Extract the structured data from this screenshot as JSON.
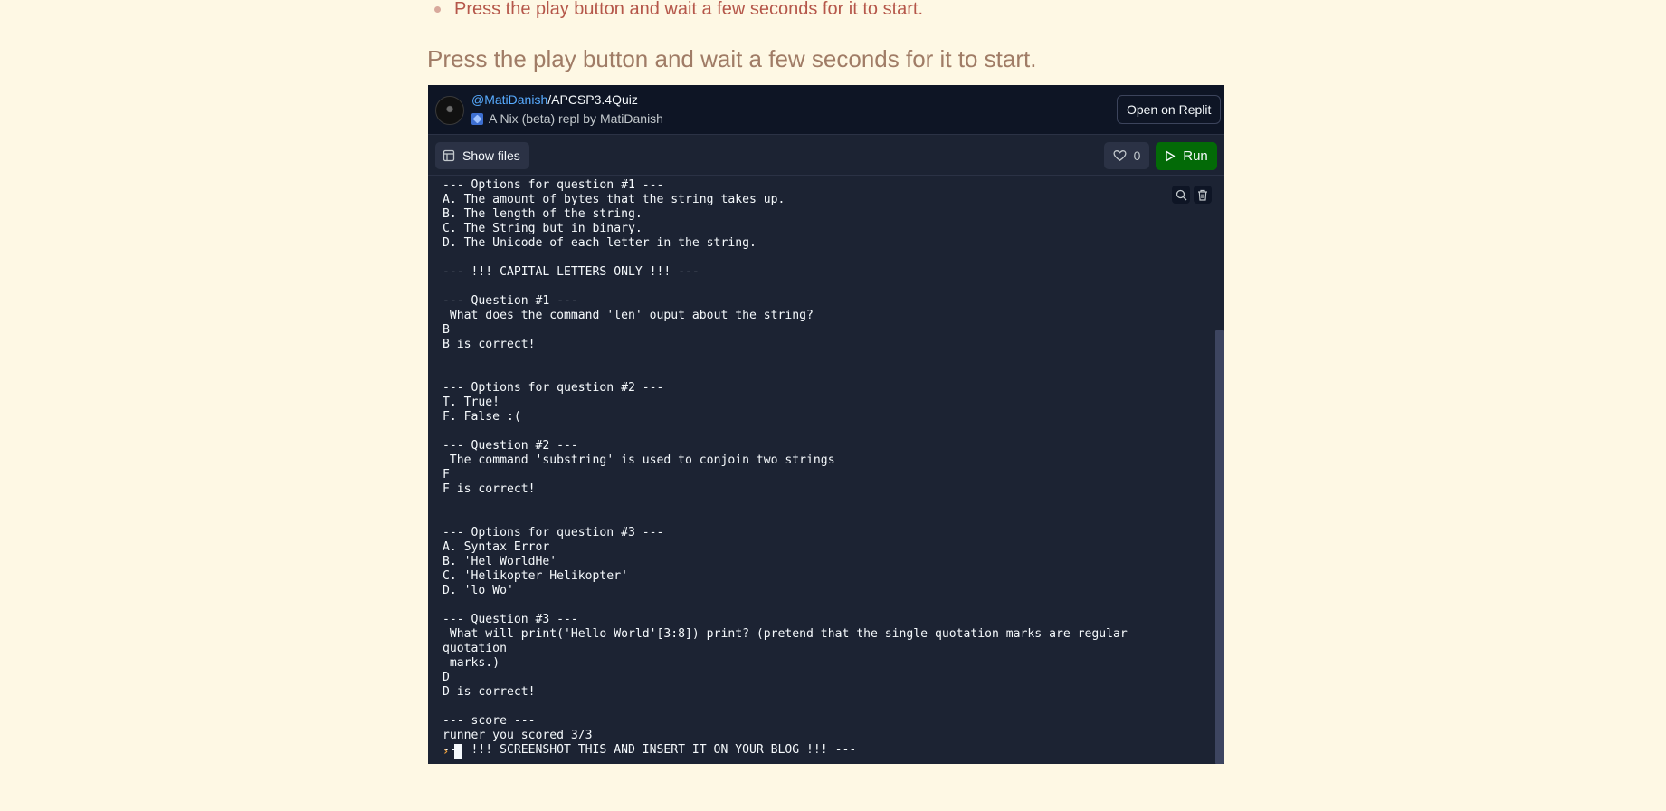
{
  "page": {
    "bullet_text": "Press the play button and wait a few seconds for it to start.",
    "heading": "Press the play button and wait a few seconds for it to start."
  },
  "embed": {
    "owner": "@MatiDanish",
    "separator": "/",
    "repl_name": "APCSP3.4Quiz",
    "subtitle": "A Nix (beta) repl by MatiDanish",
    "open_button": "Open on Replit",
    "show_files_button": "Show files",
    "like_count": "0",
    "run_button": "Run"
  },
  "console": {
    "lines": [
      "--- Options for question #1 ---",
      "A. The amount of bytes that the string takes up.",
      "B. The length of the string.",
      "C. The String but in binary.",
      "D. The Unicode of each letter in the string.",
      "",
      "--- !!! CAPITAL LETTERS ONLY !!! ---",
      "",
      "--- Question #1 ---",
      " What does the command 'len' ouput about the string?",
      "B",
      "B is correct!",
      "",
      "",
      "--- Options for question #2 ---",
      "T. True!",
      "F. False :(",
      "",
      "--- Question #2 ---",
      " The command 'substring' is used to conjoin two strings",
      "F",
      "F is correct!",
      "",
      "",
      "--- Options for question #3 ---",
      "A. Syntax Error",
      "B. 'Hel WorldHe'",
      "C. 'Helikopter Helikopter'",
      "D. 'lo Wo'",
      "",
      "--- Question #3 ---",
      " What will print('Hello World'[3:8]) print? (pretend that the single quotation marks are regular quotation",
      " marks.)",
      "D",
      "D is correct!",
      "",
      "--- score ---",
      "runner you scored 3/3",
      "--- !!! SCREENSHOT THIS AND INSERT IT ON YOUR BLOG !!! ---"
    ],
    "prompt_glyph": "›"
  }
}
